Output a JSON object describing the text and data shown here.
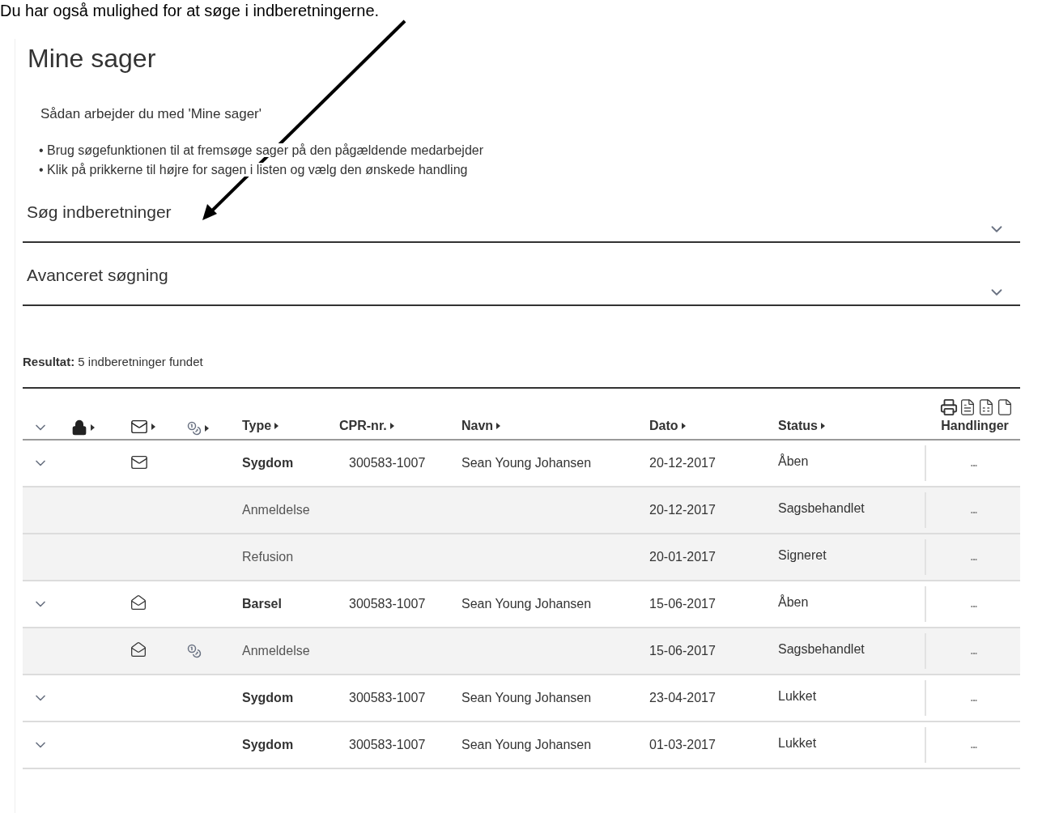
{
  "caption": "Du har også mulighed for at søge i indberetningerne.",
  "page": {
    "title": "Mine sager",
    "intro": "Sådan arbejder du med 'Mine sager'",
    "bullets": [
      "• Brug søgefunktionen til at fremsøge sager på den pågældende medarbejder",
      "• Klik på prikkerne til højre for sagen i listen og vælg den ønskede handling"
    ]
  },
  "accordions": [
    {
      "label": "Søg indberetninger",
      "expanded": false
    },
    {
      "label": "Avanceret søgning",
      "expanded": false
    }
  ],
  "result": "**Resultat:** 5 indberetninger fundet",
  "table": {
    "columns": [
      {
        "kind": "chevron"
      },
      {
        "kind": "lock",
        "sortable": true
      },
      {
        "kind": "mail",
        "sortable": true
      },
      {
        "kind": "coins",
        "sortable": true
      },
      {
        "kind": "text",
        "label": "Type",
        "sortable": true
      },
      {
        "kind": "text",
        "label": "CPR-nr.",
        "sortable": true
      },
      {
        "kind": "text",
        "label": "Navn",
        "sortable": true
      },
      {
        "kind": "text",
        "label": "Dato",
        "sortable": true
      },
      {
        "kind": "text",
        "label": "Status",
        "sortable": true
      },
      {
        "kind": "text",
        "label": "Handlinger",
        "sortable": false
      }
    ],
    "rows": [
      {
        "kind": "case",
        "expanded": false,
        "mail": true,
        "mail_read": false,
        "coins": false,
        "type": "Sygdom",
        "cpr": "300583-1007",
        "name": "Sean Young Johansen",
        "date": "20-12-2017",
        "status": "Åben",
        "actions": "..."
      },
      {
        "kind": "sub",
        "mail": false,
        "coins": false,
        "type": "Anmeldelse",
        "date": "20-12-2017",
        "status": "Sagsbehandlet",
        "actions": "..."
      },
      {
        "kind": "sub",
        "mail": false,
        "coins": false,
        "type": "Refusion",
        "date": "20-01-2017",
        "status": "Signeret",
        "actions": "..."
      },
      {
        "kind": "case",
        "expanded": false,
        "mail": true,
        "mail_read": true,
        "coins": false,
        "type": "Barsel",
        "cpr": "300583-1007",
        "name": "Sean Young Johansen",
        "date": "15-06-2017",
        "status": "Åben",
        "actions": "..."
      },
      {
        "kind": "sub",
        "mail": true,
        "mail_read": true,
        "coins": true,
        "type": "Anmeldelse",
        "date": "15-06-2017",
        "status": "Sagsbehandlet",
        "actions": "..."
      },
      {
        "kind": "case",
        "expanded": false,
        "mail": false,
        "coins": false,
        "type": "Sygdom",
        "cpr": "300583-1007",
        "name": "Sean Young Johansen",
        "date": "23-04-2017",
        "status": "Lukket",
        "actions": "..."
      },
      {
        "kind": "case",
        "expanded": false,
        "mail": false,
        "coins": false,
        "type": "Sygdom",
        "cpr": "300583-1007",
        "name": "Sean Young Johansen",
        "date": "01-03-2017",
        "status": "Lukket",
        "actions": "..."
      }
    ]
  }
}
